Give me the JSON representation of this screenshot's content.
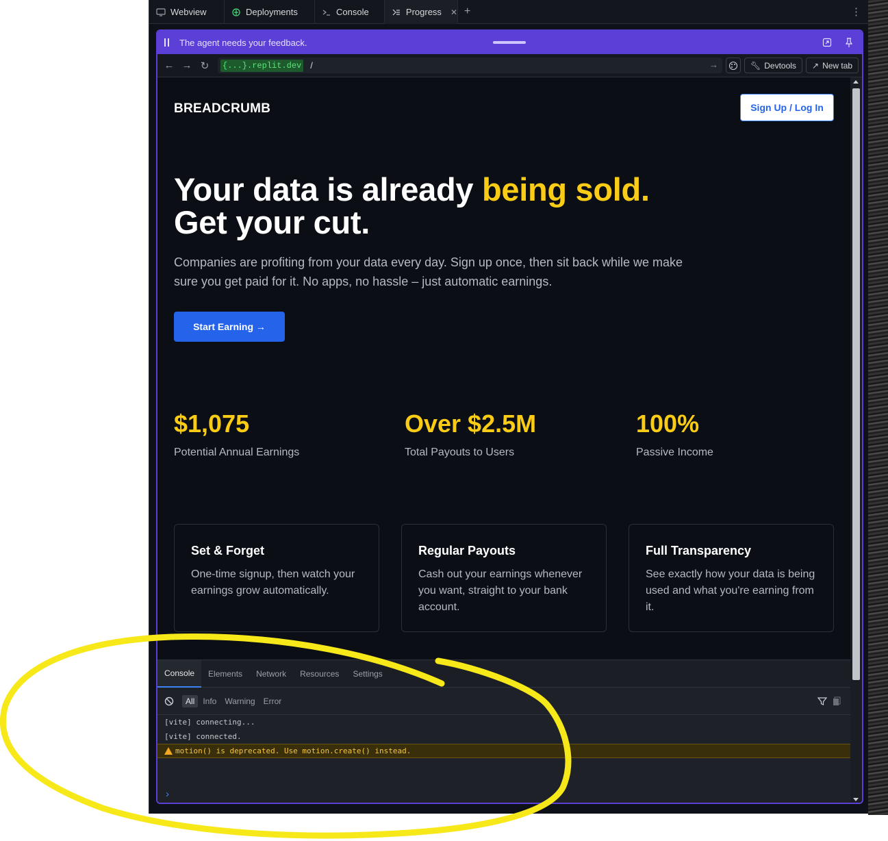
{
  "ide": {
    "tabs": [
      {
        "label": "Webview",
        "icon": "monitor-icon"
      },
      {
        "label": "Deployments",
        "icon": "deployments-icon"
      },
      {
        "label": "Console",
        "icon": "terminal-icon"
      },
      {
        "label": "Progress",
        "icon": "progress-icon",
        "active": true
      }
    ],
    "add_tab": "+",
    "more": "⋮"
  },
  "feedback": {
    "text": "The agent needs your feedback."
  },
  "urlbar": {
    "host": "{...}.replit.dev",
    "path": "/",
    "devtools_label": "Devtools",
    "new_tab_label": "New tab"
  },
  "page": {
    "brand": "BREADCRUMB",
    "signup_label": "Sign Up / Log In",
    "hero": {
      "line1_prefix": "Your data is already ",
      "line1_highlight": "being sold.",
      "line2": "Get your cut.",
      "subtitle": "Companies are profiting from your data every day. Sign up once, then sit back while we make sure you get paid for it. No apps, no hassle – just automatic earnings."
    },
    "cta_label": "Start Earning →",
    "stats": [
      {
        "value": "$1,075",
        "label": "Potential Annual Earnings"
      },
      {
        "value": "Over $2.5M",
        "label": "Total Payouts to Users"
      },
      {
        "value": "100%",
        "label": "Passive Income"
      }
    ],
    "cards": [
      {
        "title": "Set & Forget",
        "text": "One-time signup, then watch your earnings grow automatically."
      },
      {
        "title": "Regular Payouts",
        "text": "Cash out your earnings whenever you want, straight to your bank account."
      },
      {
        "title": "Full Transparency",
        "text": "See exactly how your data is being used and what you're earning from it."
      }
    ]
  },
  "devtools": {
    "tabs": [
      "Console",
      "Elements",
      "Network",
      "Resources",
      "Settings"
    ],
    "levels": [
      "All",
      "Info",
      "Warning",
      "Error"
    ],
    "logs": [
      {
        "text": "[vite] connecting...",
        "level": "log"
      },
      {
        "text": "[vite] connected.",
        "level": "log"
      },
      {
        "text": "motion() is deprecated. Use motion.create() instead.",
        "level": "warn"
      }
    ],
    "prompt": "›"
  },
  "colors": {
    "accent_purple": "#5b3fd6",
    "highlight_yellow": "#facc15",
    "cta_blue": "#2563eb",
    "annotation_yellow": "#f7e81a"
  }
}
